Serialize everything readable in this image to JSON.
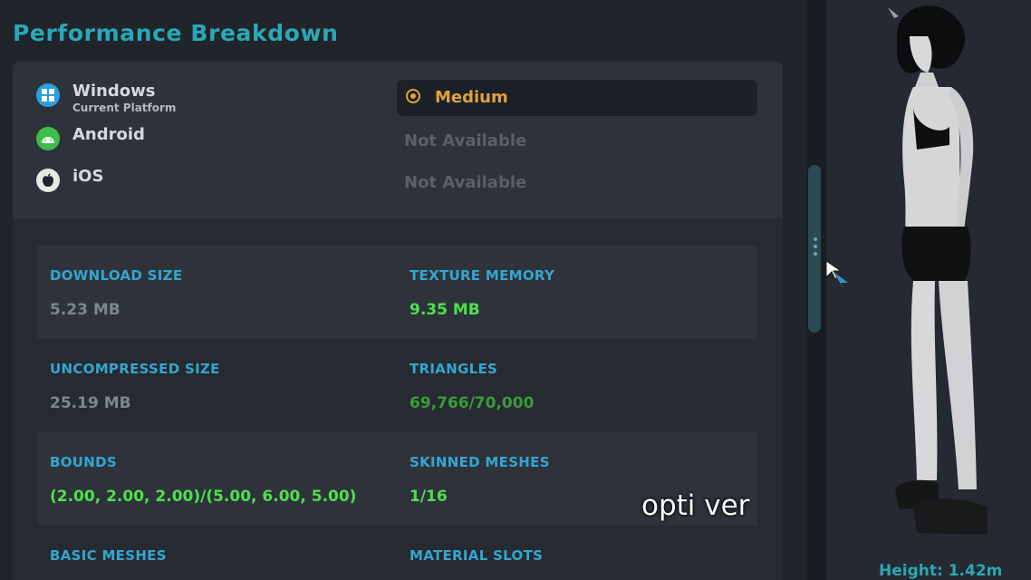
{
  "title": "Performance Breakdown",
  "platforms": [
    {
      "name": "Windows",
      "sub": "Current Platform",
      "status": "Medium",
      "icon": "windows-icon",
      "color": "#2aa0e0"
    },
    {
      "name": "Android",
      "sub": "",
      "status": "Not Available",
      "icon": "android-icon",
      "color": "#3cbf4a"
    },
    {
      "name": "iOS",
      "sub": "",
      "status": "Not Available",
      "icon": "apple-icon",
      "color": "#e8e8e8"
    }
  ],
  "stats": [
    {
      "label": "DOWNLOAD SIZE",
      "value": "5.23 MB",
      "color": "#7d8790"
    },
    {
      "label": "TEXTURE MEMORY",
      "value": "9.35 MB",
      "color": "#4fe04a"
    },
    {
      "label": "UNCOMPRESSED SIZE",
      "value": "25.19 MB",
      "color": "#7d8790"
    },
    {
      "label": "TRIANGLES",
      "value": "69,766/70,000",
      "color": "#3a9c3a"
    },
    {
      "label": "BOUNDS",
      "value": "(2.00, 2.00, 2.00)/(5.00, 6.00, 5.00)",
      "color": "#4fe04a"
    },
    {
      "label": "SKINNED MESHES",
      "value": "1/16",
      "color": "#4fe04a"
    },
    {
      "label": "BASIC MESHES",
      "value": "",
      "color": "#4fe04a"
    },
    {
      "label": "MATERIAL SLOTS",
      "value": "",
      "color": "#4fe04a"
    }
  ],
  "preview": {
    "height_label": "Height: 1.42m"
  },
  "caption": "opti ver",
  "colors": {
    "accent": "#2aa8b6",
    "medium": "#e0a33a",
    "good": "#4fe04a"
  }
}
